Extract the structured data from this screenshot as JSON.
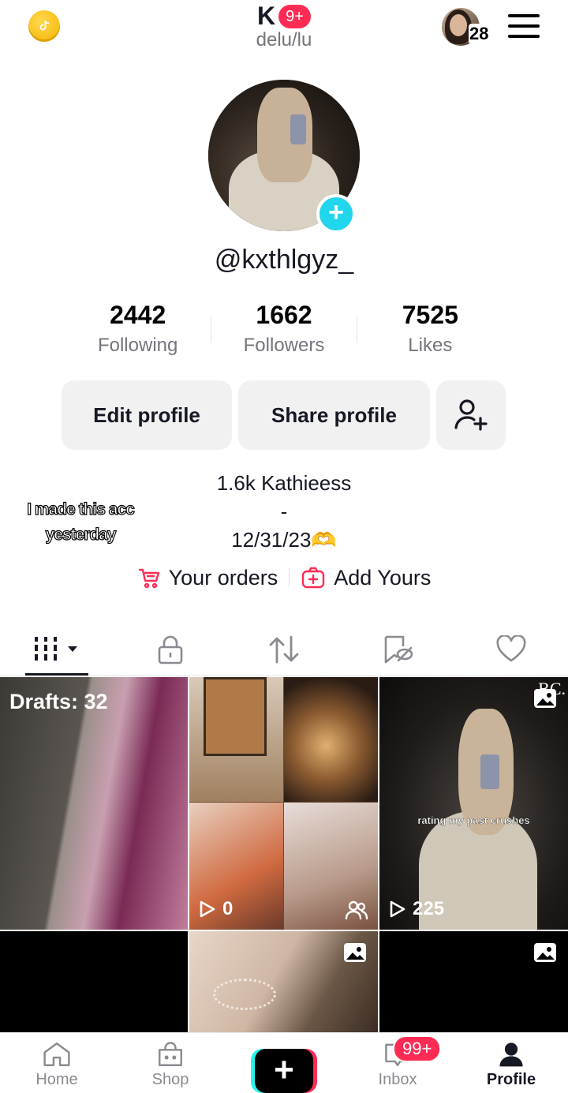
{
  "header": {
    "title": "K",
    "notification_badge": "9+",
    "subtitle": "delu/lu",
    "account_count": "28"
  },
  "profile": {
    "username": "@kxthlgyz_",
    "stats": [
      {
        "value": "2442",
        "label": "Following"
      },
      {
        "value": "1662",
        "label": "Followers"
      },
      {
        "value": "7525",
        "label": "Likes"
      }
    ],
    "buttons": {
      "edit": "Edit profile",
      "share": "Share profile"
    },
    "bio_lines": [
      "1.6k Kathieess",
      "-",
      "12/31/23🫶"
    ],
    "sticker_text": [
      "I made this acc",
      "yesterday"
    ],
    "links": {
      "orders": "Your orders",
      "add_yours": "Add Yours"
    }
  },
  "tabs": [
    "videos-tab",
    "private-tab",
    "reposts-tab",
    "favorites-tab",
    "liked-tab"
  ],
  "grid": {
    "drafts_label": "Drafts: 32",
    "tile2_views": "0",
    "tile3_views": "225",
    "tile3_caption": "rating my past crushes",
    "tile3_watermark": "BC."
  },
  "bottom_nav": {
    "home": "Home",
    "shop": "Shop",
    "inbox": "Inbox",
    "inbox_badge": "99+",
    "profile": "Profile"
  },
  "colors": {
    "accent_red": "#fe2c55",
    "accent_cyan": "#20d5ec",
    "text_primary": "#161823",
    "text_secondary": "#73757c",
    "button_bg": "#f1f1f2"
  }
}
